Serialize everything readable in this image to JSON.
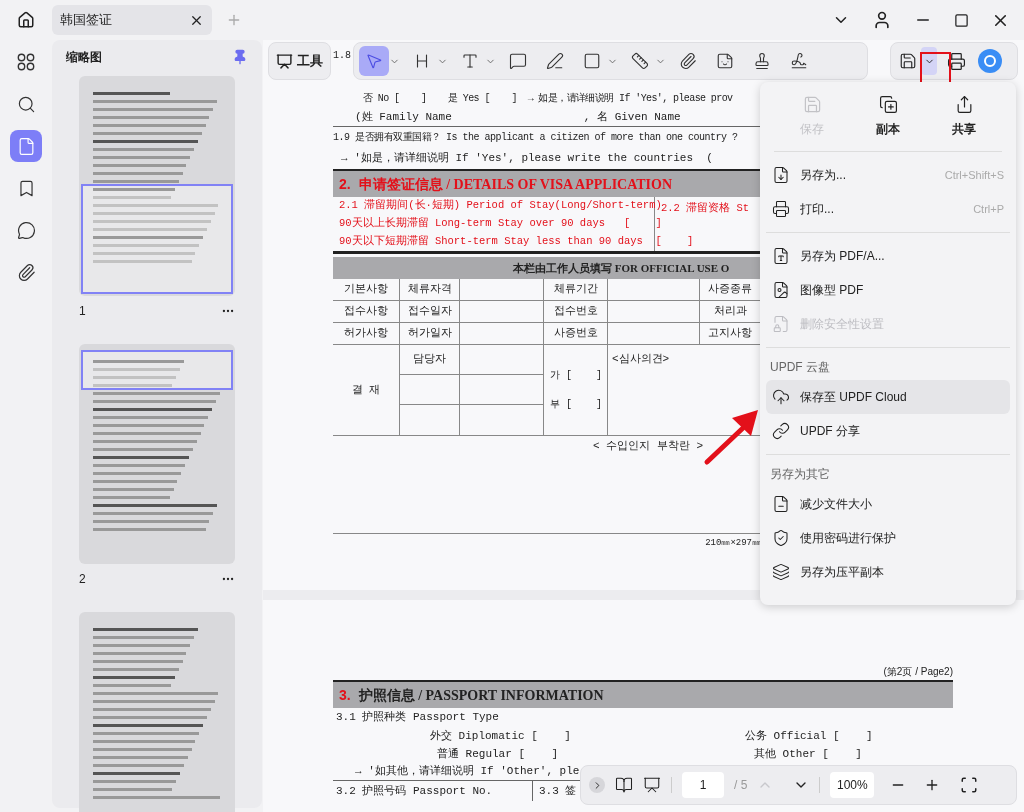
{
  "tabs": [
    {
      "label": "韩国签证",
      "selected": true
    }
  ],
  "rail": [
    {
      "selected": false
    },
    {
      "selected": false
    },
    {
      "selected": true
    },
    {
      "selected": false
    },
    {
      "selected": false
    },
    {
      "selected": false
    }
  ],
  "thumbnails": {
    "title": "缩略图",
    "pages": [
      {
        "label": "1"
      },
      {
        "label": "2"
      }
    ]
  },
  "toolbar": {
    "tools_button": "工具",
    "tools": [
      {
        "selected": true,
        "dropdown": true
      },
      {
        "selected": false,
        "dropdown": true
      },
      {
        "selected": false,
        "dropdown": true
      },
      {
        "selected": false,
        "dropdown": false
      },
      {
        "selected": false,
        "dropdown": false
      },
      {
        "selected": false,
        "dropdown": true
      },
      {
        "selected": false,
        "dropdown": true
      },
      {
        "selected": false,
        "dropdown": false
      },
      {
        "selected": false,
        "dropdown": false
      },
      {
        "selected": false,
        "dropdown": false
      },
      {
        "selected": false,
        "dropdown": false
      }
    ],
    "save_menu_expanded": true
  },
  "page1": {
    "top_label": "1.8",
    "q18_answer": "否 No [    ]    是 Yes [    ]  → 如是，请详细说明 If 'Yes', please prov",
    "q18_names": "(姓 Family Name                    , 名 Given Name",
    "q19": "1.9 是否拥有双重国籍？ Is the applicant a citizen of more than one country ?",
    "q19_detail": "→ '如是，请详细说明 If 'Yes', please write the countries  (",
    "section_number": "2.",
    "section_title": "申请签证信息 / DETAILS OF VISA APPLICATION",
    "stay_lines": [
      "2.1 滞留期间(长·短期) Period of Stay(Long/Short-term)",
      "90天以上长期滞留 Long-term Stay over 90 days   [    ]",
      "90天以下短期滞留 Short-term Stay less than 90 days  [    ]"
    ],
    "status_cell": "2.2 滞留资格 St",
    "official_header": "本栏由工作人员填写 FOR OFFICIAL USE O",
    "official_rows": [
      [
        "기본사항",
        "체류자격",
        "",
        "체류기간",
        "",
        "사증종류"
      ],
      [
        "접수사항",
        "접수일자",
        "",
        "접수번호",
        "",
        "처리과"
      ],
      [
        "허가사항",
        "허가일자",
        "",
        "사증번호",
        "",
        "고지사항"
      ]
    ],
    "approval_label": "결 재",
    "approval_person": "담당자",
    "approve_yes": "가 [    ]",
    "approve_no": "부 [    ]",
    "review_opinion": "<심사의견>",
    "stamp_area": "< 수입인지 부착란 >",
    "paper_size": "210㎜×297㎜"
  },
  "page2": {
    "page_label": "(第2页 / Page2)",
    "section_number": "3.",
    "section_title": "护照信息 / PASSPORT INFORMATION",
    "type_label": "3.1 护照种类 Passport Type",
    "options": [
      [
        "外交 Diplomatic [    ]",
        "公务 Official [    ]"
      ],
      [
        "普通 Regular [    ]",
        "其他 Other [    ]"
      ]
    ],
    "other_detail": "→ '如其他，请详细说明 If 'Other', ple",
    "passport_no": "3.2 护照号码 Passport No.",
    "cell_33": "3.3 签"
  },
  "menu": {
    "top": [
      {
        "label": "保存",
        "disabled": true
      },
      {
        "label": "副本",
        "disabled": false
      },
      {
        "label": "共享",
        "disabled": false
      }
    ],
    "sections": [
      {
        "items": [
          {
            "label": "另存为...",
            "shortcut": "Ctrl+Shift+S",
            "disabled": false,
            "hovered": false
          },
          {
            "label": "打印...",
            "shortcut": "Ctrl+P",
            "disabled": false,
            "hovered": false
          }
        ]
      },
      {
        "items": [
          {
            "label": "另存为 PDF/A...",
            "disabled": false,
            "hovered": false
          },
          {
            "label": "图像型 PDF",
            "disabled": false,
            "hovered": false
          },
          {
            "label": "删除安全性设置",
            "disabled": true,
            "hovered": false
          }
        ]
      },
      {
        "heading": "UPDF 云盘",
        "items": [
          {
            "label": "保存至 UPDF Cloud",
            "disabled": false,
            "hovered": true
          },
          {
            "label": "UPDF 分享",
            "disabled": false,
            "hovered": false
          }
        ]
      },
      {
        "heading": "另存为其它",
        "items": [
          {
            "label": "减少文件大小",
            "disabled": false,
            "hovered": false
          },
          {
            "label": "使用密码进行保护",
            "disabled": false,
            "hovered": false
          },
          {
            "label": "另存为压平副本",
            "disabled": false,
            "hovered": false
          }
        ]
      }
    ]
  },
  "bottom_bar": {
    "page": "1",
    "total": "/ 5",
    "prev_disabled": true,
    "zoom": "100%"
  }
}
